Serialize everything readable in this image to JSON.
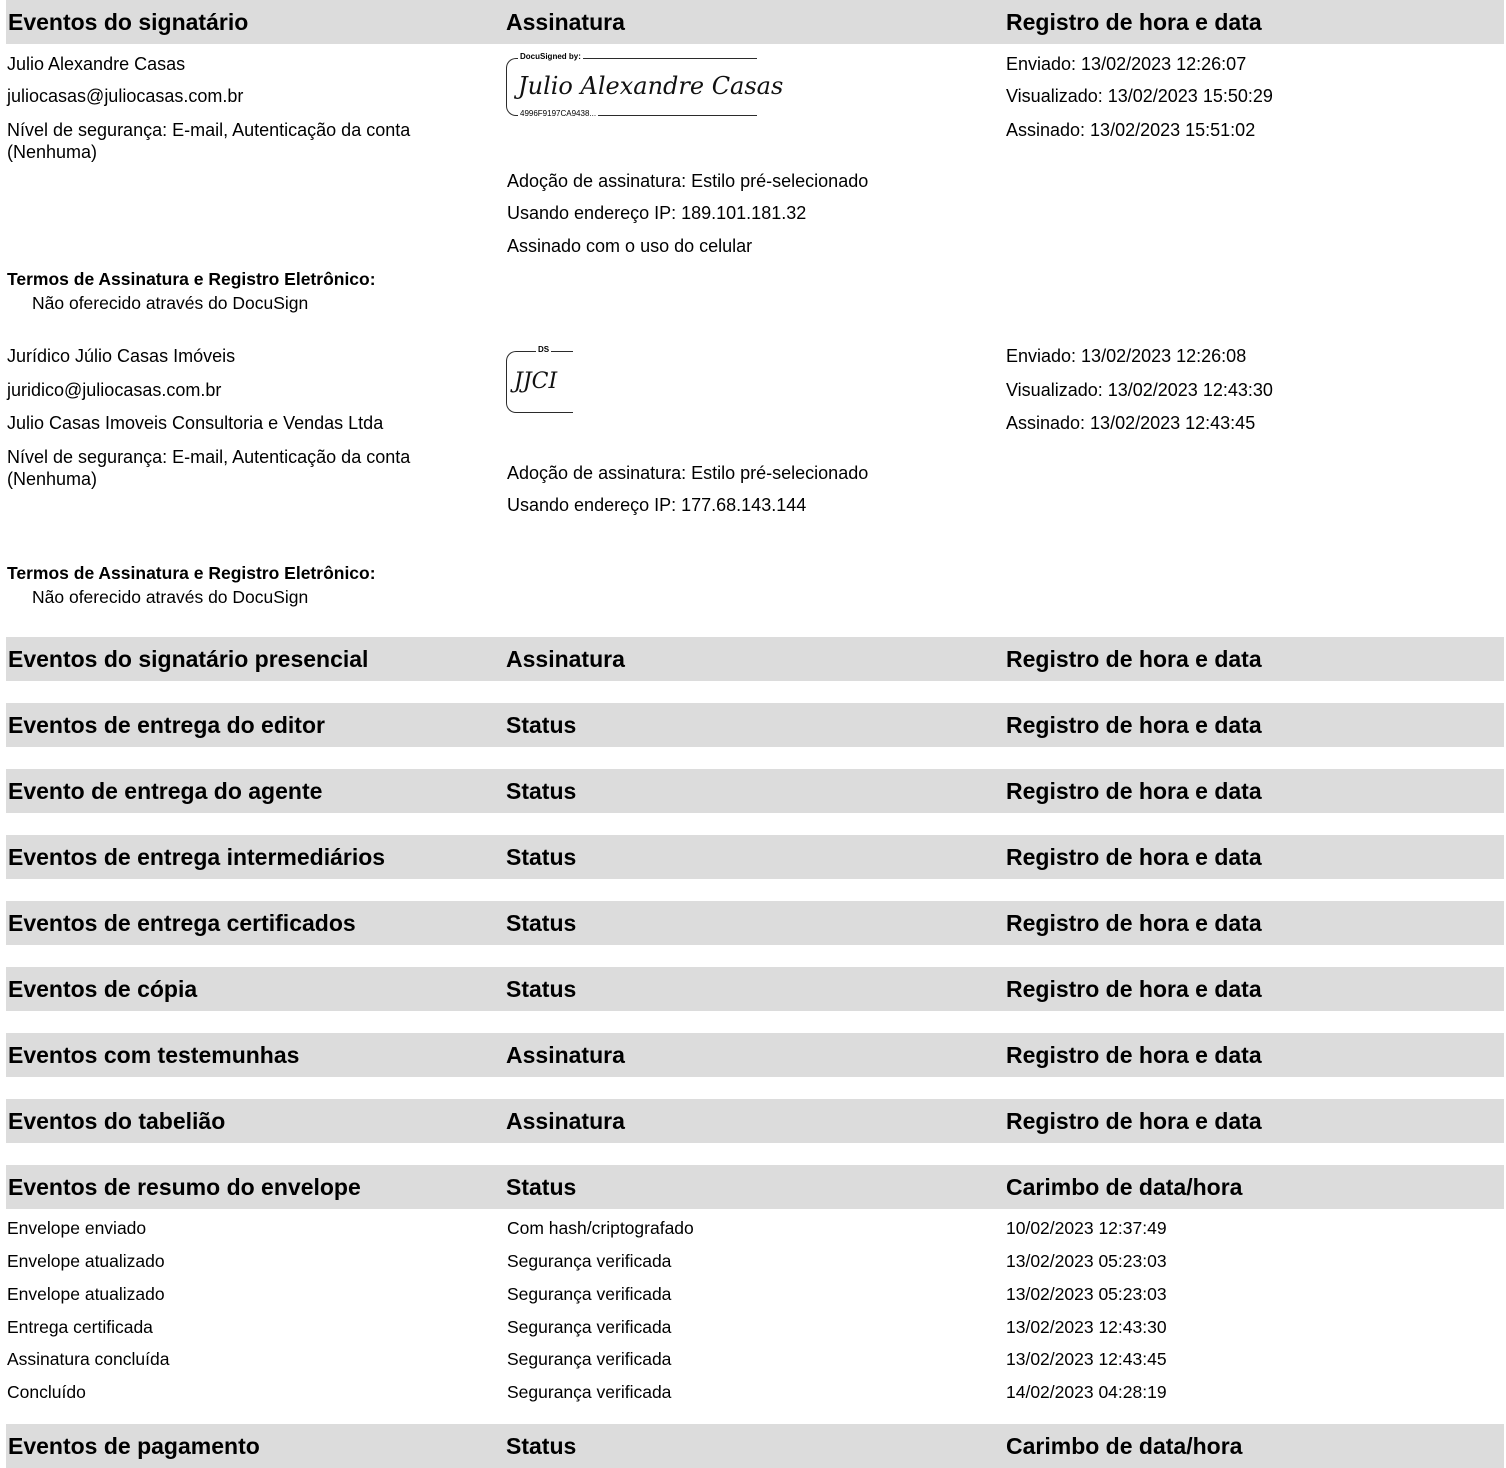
{
  "header_signer": {
    "c1": "Eventos do signatário",
    "c2": "Assinatura",
    "c3": "Registro de hora e data"
  },
  "signer1": {
    "name": "Julio Alexandre Casas",
    "email": "juliocasas@juliocasas.com.br",
    "security": "Nível de segurança: E-mail, Autenticação da conta (Nenhuma)",
    "sig_caption": "DocuSigned by:",
    "sig_text": "Julio Alexandre Casas",
    "sig_id": "4996F9197CA9438...",
    "adoption": "Adoção de assinatura: Estilo pré-selecionado",
    "ip": "Usando endereço IP: 189.101.181.32",
    "mobile": "Assinado com o uso do celular",
    "sent": "Enviado: 13/02/2023 12:26:07",
    "viewed": "Visualizado: 13/02/2023 15:50:29",
    "signed": "Assinado: 13/02/2023 15:51:02",
    "terms_label": "Termos de Assinatura e Registro Eletrônico:",
    "terms_value": "Não oferecido através do DocuSign"
  },
  "signer2": {
    "name": "Jurídico Júlio Casas Imóveis",
    "email": "juridico@juliocasas.com.br",
    "company": "Julio Casas Imoveis Consultoria e Vendas Ltda",
    "security": "Nível de segurança: E-mail, Autenticação da conta (Nenhuma)",
    "sig_caption": "DS",
    "sig_text": "JJCI",
    "adoption": "Adoção de assinatura: Estilo pré-selecionado",
    "ip": "Usando endereço IP: 177.68.143.144",
    "sent": "Enviado: 13/02/2023 12:26:08",
    "viewed": "Visualizado: 13/02/2023 12:43:30",
    "signed": "Assinado: 13/02/2023 12:43:45",
    "terms_label": "Termos de Assinatura e Registro Eletrônico:",
    "terms_value": "Não oferecido através do DocuSign"
  },
  "sections": [
    {
      "c1": "Eventos do signatário presencial",
      "c2": "Assinatura",
      "c3": "Registro de hora e data"
    },
    {
      "c1": "Eventos de entrega do editor",
      "c2": "Status",
      "c3": "Registro de hora e data"
    },
    {
      "c1": "Evento de entrega do agente",
      "c2": "Status",
      "c3": "Registro de hora e data"
    },
    {
      "c1": "Eventos de entrega intermediários",
      "c2": "Status",
      "c3": "Registro de hora e data"
    },
    {
      "c1": "Eventos de entrega certificados",
      "c2": "Status",
      "c3": "Registro de hora e data"
    },
    {
      "c1": "Eventos de cópia",
      "c2": "Status",
      "c3": "Registro de hora e data"
    },
    {
      "c1": "Eventos com testemunhas",
      "c2": "Assinatura",
      "c3": "Registro de hora e data"
    },
    {
      "c1": "Eventos do tabelião",
      "c2": "Assinatura",
      "c3": "Registro de hora e data"
    }
  ],
  "summary_header": {
    "c1": "Eventos de resumo do envelope",
    "c2": "Status",
    "c3": "Carimbo de data/hora"
  },
  "summary_rows": [
    {
      "event": "Envelope enviado",
      "status": "Com hash/criptografado",
      "time": "10/02/2023 12:37:49"
    },
    {
      "event": "Envelope atualizado",
      "status": "Segurança verificada",
      "time": "13/02/2023 05:23:03"
    },
    {
      "event": "Envelope atualizado",
      "status": "Segurança verificada",
      "time": "13/02/2023 05:23:03"
    },
    {
      "event": "Entrega certificada",
      "status": "Segurança verificada",
      "time": "13/02/2023 12:43:30"
    },
    {
      "event": "Assinatura concluída",
      "status": "Segurança verificada",
      "time": "13/02/2023 12:43:45"
    },
    {
      "event": "Concluído",
      "status": "Segurança verificada",
      "time": "14/02/2023 04:28:19"
    }
  ],
  "payment_header": {
    "c1": "Eventos de pagamento",
    "c2": "Status",
    "c3": "Carimbo de data/hora"
  }
}
